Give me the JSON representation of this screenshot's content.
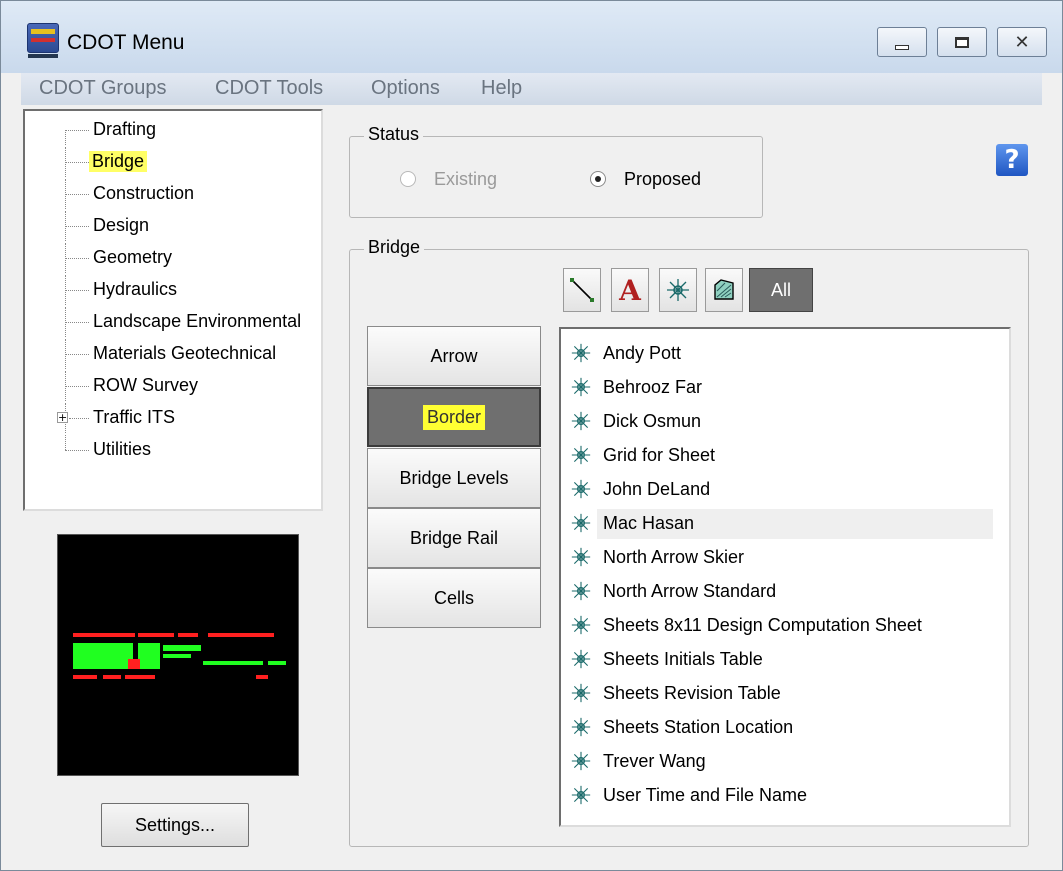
{
  "window": {
    "title": "CDOT Menu"
  },
  "menubar": {
    "items": [
      "CDOT Groups",
      "CDOT Tools",
      "Options",
      "Help"
    ]
  },
  "tree": {
    "items": [
      {
        "label": "Drafting",
        "selected": false,
        "expandable": false
      },
      {
        "label": "Bridge",
        "selected": true,
        "expandable": false
      },
      {
        "label": "Construction",
        "selected": false,
        "expandable": false
      },
      {
        "label": "Design",
        "selected": false,
        "expandable": false
      },
      {
        "label": "Geometry",
        "selected": false,
        "expandable": false
      },
      {
        "label": "Hydraulics",
        "selected": false,
        "expandable": false
      },
      {
        "label": "Landscape Environmental",
        "selected": false,
        "expandable": false
      },
      {
        "label": "Materials Geotechnical",
        "selected": false,
        "expandable": false
      },
      {
        "label": "ROW Survey",
        "selected": false,
        "expandable": false
      },
      {
        "label": "Traffic ITS",
        "selected": false,
        "expandable": true
      },
      {
        "label": "Utilities",
        "selected": false,
        "expandable": false
      }
    ],
    "expander_glyph": "+"
  },
  "settings": {
    "label": "Settings..."
  },
  "status": {
    "label": "Status",
    "options": [
      {
        "label": "Existing",
        "checked": false,
        "enabled": false
      },
      {
        "label": "Proposed",
        "checked": true,
        "enabled": true
      }
    ]
  },
  "help": {
    "glyph": "?"
  },
  "bridge": {
    "label": "Bridge",
    "toolbar": {
      "buttons": [
        "line-icon",
        "text-icon",
        "cell-icon",
        "pattern-icon"
      ],
      "text_glyph": "A",
      "all_label": "All"
    },
    "categories": [
      {
        "label": "Arrow",
        "active": false
      },
      {
        "label": "Border",
        "active": true
      },
      {
        "label": "Bridge Levels",
        "active": false
      },
      {
        "label": "Bridge Rail",
        "active": false
      },
      {
        "label": "Cells",
        "active": false
      }
    ],
    "items": [
      "Andy Pott",
      "Behrooz Far",
      "Dick Osmun",
      "Grid for Sheet",
      "John DeLand",
      "Mac Hasan",
      "North Arrow Skier",
      "North Arrow Standard",
      "Sheets 8x11 Design Computation Sheet",
      "Sheets Initials Table",
      "Sheets Revision Table",
      "Sheets Station Location",
      "Trever Wang",
      "User Time and File Name"
    ],
    "hovered_item": "Mac Hasan"
  },
  "colors": {
    "preview_bg": "#000000",
    "preview_red": "#ff2020",
    "preview_green": "#20ff20",
    "highlight": "#ffff33",
    "active_button": "#6f6f6f"
  }
}
